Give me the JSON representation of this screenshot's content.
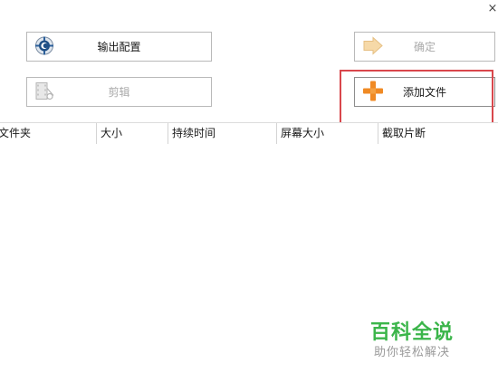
{
  "window": {
    "close_glyph": "×"
  },
  "toolbar": {
    "output_config": {
      "label": "输出配置",
      "icon": "gear-icon",
      "enabled": true
    },
    "confirm": {
      "label": "确定",
      "icon": "arrow-right-icon",
      "enabled": false
    },
    "cut": {
      "label": "剪辑",
      "icon": "film-scissors-icon",
      "enabled": false
    },
    "add_file": {
      "label": "添加文件",
      "icon": "plus-icon",
      "enabled": true
    }
  },
  "file_table": {
    "columns": [
      {
        "key": "folder",
        "label": "文件夹"
      },
      {
        "key": "size",
        "label": "大小"
      },
      {
        "key": "duration",
        "label": "持续时间"
      },
      {
        "key": "resolution",
        "label": "屏幕大小"
      },
      {
        "key": "clip",
        "label": "截取片断"
      }
    ],
    "rows": []
  },
  "watermark": {
    "title": "百科全说",
    "subtitle": "助你轻松解决"
  },
  "colors": {
    "highlight": "#d9474c",
    "plus_orange": "#f08a24",
    "watermark_green": "#3bb54a",
    "disabled_text": "#a9a9a9"
  }
}
